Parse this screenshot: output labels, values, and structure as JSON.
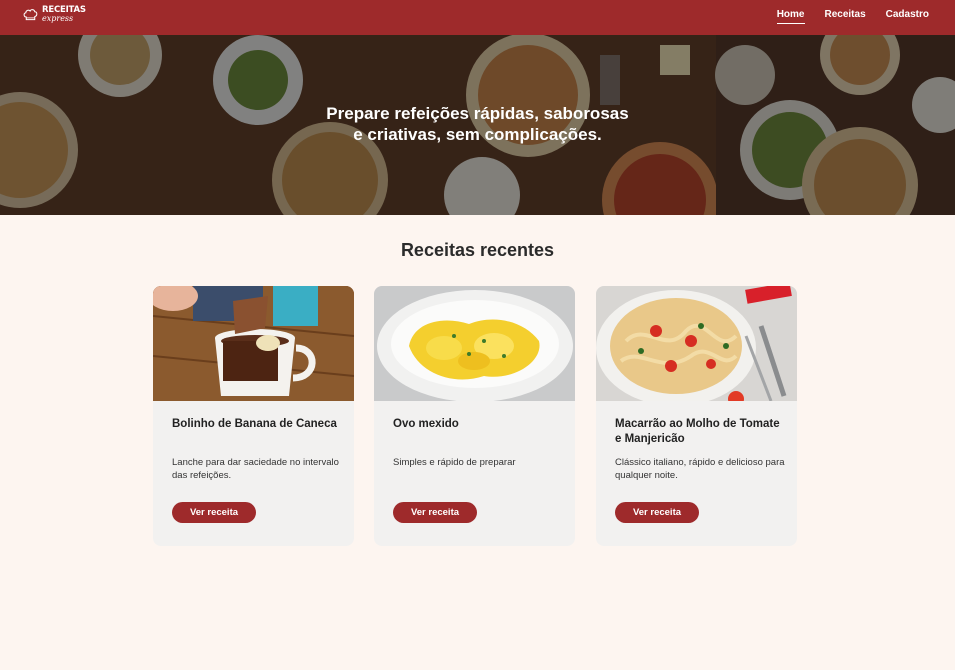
{
  "brand": {
    "line1": "RECEITAS",
    "line2": "express"
  },
  "nav": {
    "home": "Home",
    "receitas": "Receitas",
    "cadastro": "Cadastro"
  },
  "hero": {
    "line1": "Prepare refeições rápidas, saborosas",
    "line2": "e criativas, sem complicações."
  },
  "section": {
    "title": "Receitas recentes"
  },
  "cards": [
    {
      "title": "Bolinho de Banana de Caneca",
      "description": "Lanche para dar saciedade no intervalo das refeições.",
      "button": "Ver receita"
    },
    {
      "title": "Ovo mexido",
      "description": "Simples e rápido de preparar",
      "button": "Ver receita"
    },
    {
      "title": "Macarrão ao Molho de Tomate e Manjericão",
      "description": "Clássico italiano, rápido e delicioso para qualquer noite.",
      "button": "Ver receita"
    }
  ],
  "colors": {
    "primary": "#9e2a2b",
    "background": "#fdf5f0",
    "card": "#f2f1f0"
  }
}
